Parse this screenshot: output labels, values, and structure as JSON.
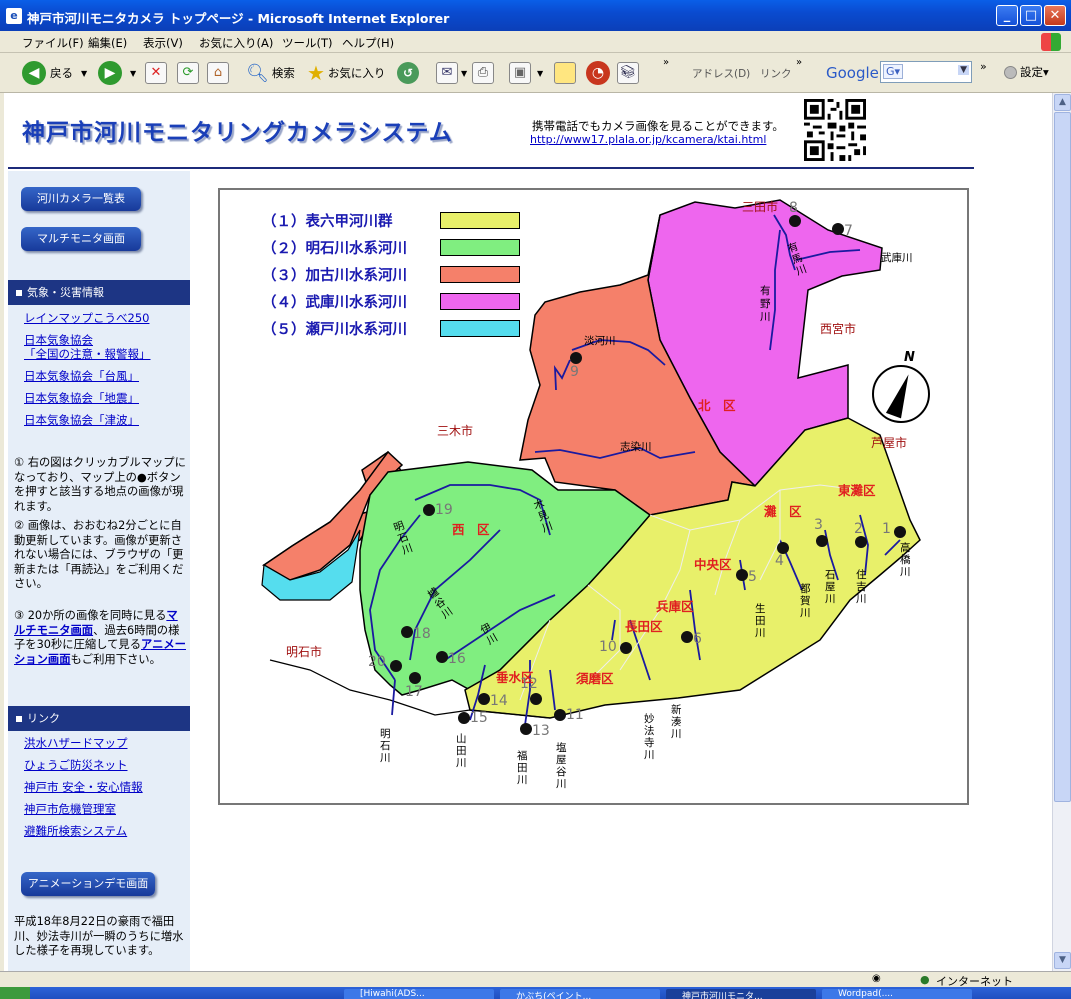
{
  "window": {
    "title": "神戸市河川モニタカメラ トップページ - Microsoft Internet Explorer"
  },
  "menu": [
    "ファイル(F)",
    "編集(E)",
    "表示(V)",
    "お気に入り(A)",
    "ツール(T)",
    "ヘルプ(H)"
  ],
  "toolbar": {
    "back": "戻る",
    "search": "検索",
    "favorites": "お気に入り",
    "address_label": "アドレス(D)",
    "links_label": "リンク",
    "google_logo": "Google",
    "google_g": "G▾",
    "settings": "設定▾"
  },
  "header": {
    "title": "神戸市河川モニタリングカメラシステム",
    "mobile_note": "携帯電話でもカメラ画像を見ることができます。",
    "mobile_url": "http://www17.plala.or.jp/kcamera/ktai.html"
  },
  "sidebar": {
    "btn_river_list": "河川カメラ一覧表",
    "btn_multi_monitor": "マルチモニタ画面",
    "weather_head": "気象・災害情報",
    "weather_links": [
      "レインマップこうべ250",
      "日本気象協会",
      "「全国の注意・報警報」",
      "日本気象協会「台風」",
      "日本気象協会「地震」",
      "日本気象協会「津波」"
    ],
    "note1": "① 右の図はクリッカブルマップになっており、マップ上の●ボタンを押すと該当する地点の画像が現れます。",
    "note2": "② 画像は、おおむね2分ごとに自動更新しています。画像が更新されない場合には、ブラウザの「更新または「再読込」をご利用ください。",
    "note3_a": "③ 20か所の画像を同時に見る",
    "note3_link1": "マルチモニタ画面",
    "note3_b": "、過去6時間の様子を30秒に圧縮して見る",
    "note3_link2": "アニメーション画面",
    "note3_c": "もご利用下さい。",
    "links_head": "リンク",
    "links": [
      "洪水ハザードマップ",
      "ひょうご防災ネット",
      "神戸市 安全・安心情報",
      "神戸市危機管理室",
      "避難所検索システム"
    ],
    "btn_anim_demo": "アニメーションデモ画面",
    "demo_note": "平成18年8月22日の豪雨で福田川、妙法寺川が一瞬のうちに増水した様子を再現しています。"
  },
  "map": {
    "legend": [
      {
        "label": "（１）表六甲河川群",
        "color": "#e8f06a"
      },
      {
        "label": "（２）明石川水系河川",
        "color": "#80ee80"
      },
      {
        "label": "（３）加古川水系河川",
        "color": "#f5806a"
      },
      {
        "label": "（４）武庫川水系河川",
        "color": "#ee66ee"
      },
      {
        "label": "（５）瀬戸川水系河川",
        "color": "#55ddee"
      }
    ],
    "places": [
      "三田市",
      "西宮市",
      "三木市",
      "芦屋市",
      "明石市"
    ],
    "districts": [
      "北　区",
      "西　区",
      "灘　区",
      "東灘区",
      "中央区",
      "兵庫区",
      "長田区",
      "須磨区",
      "垂水区"
    ],
    "rivers": [
      "淡河川",
      "志染川",
      "有馬川",
      "有野川",
      "武庫川",
      "木見川",
      "明石川",
      "櫨谷川",
      "伊川",
      "高橋川",
      "住吉川",
      "石屋川",
      "都賀川",
      "生田川",
      "新湊川",
      "妙法寺川",
      "塩屋谷川",
      "福田川",
      "山田川",
      "明石川"
    ],
    "compass": "N",
    "cameras": [
      "1",
      "2",
      "3",
      "4",
      "5",
      "6",
      "7",
      "8",
      "9",
      "10",
      "11",
      "12",
      "13",
      "14",
      "15",
      "16",
      "17",
      "18",
      "19",
      "20"
    ]
  },
  "status": {
    "zone": "インターネット"
  },
  "taskbar": [
    "[Hiwahi(ADS...",
    "かぶち(ペイント...",
    "神戸市河川モニタ...",
    "Wordpad(...."
  ]
}
